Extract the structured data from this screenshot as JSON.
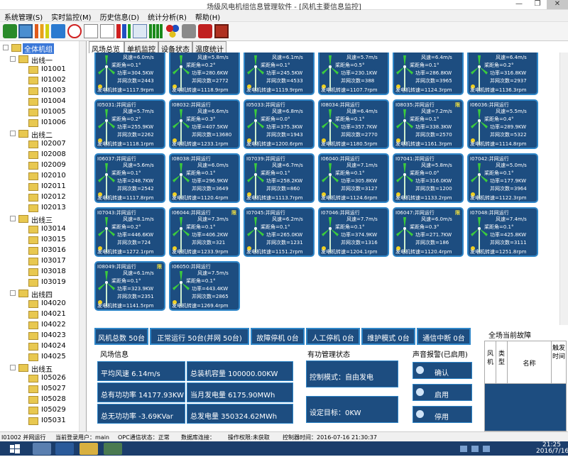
{
  "window": {
    "title": "场级风电机组信息管理软件 - [风机主要信息监控]",
    "minimize": "—",
    "restore": "❐",
    "close": "✕"
  },
  "menu": [
    "系统管理(S)",
    "实时监控(M)",
    "历史信息(D)",
    "统计分析(R)",
    "帮助(H)"
  ],
  "toolbar": [
    "refresh-icon",
    "monitor-icon",
    "bar-chart-icon",
    "area-chart-icon",
    "clock-icon",
    "line-chart-icon",
    "curve-chart-icon",
    "column-chart-icon",
    "text-chart-icon",
    "grid-icon",
    "color-circles-icon",
    "settings-icon",
    "tools-icon",
    "exit-icon"
  ],
  "tree": {
    "root": "全体机组",
    "groups": [
      {
        "name": "出线一",
        "items": [
          "I01001",
          "I01002",
          "I01003",
          "I01004",
          "I01005",
          "I01006"
        ]
      },
      {
        "name": "出线二",
        "items": [
          "I02007",
          "I02008",
          "I02009",
          "I02010",
          "I02011",
          "I02012",
          "I02013"
        ]
      },
      {
        "name": "出线三",
        "items": [
          "I03014",
          "I03015",
          "I03016",
          "I03017",
          "I03018",
          "I03019"
        ]
      },
      {
        "name": "出线四",
        "items": [
          "I04020",
          "I04021",
          "I04022",
          "I04023",
          "I04024",
          "I04025"
        ]
      },
      {
        "name": "出线五",
        "items": [
          "I05026",
          "I05027",
          "I05028",
          "I05029",
          "I05031"
        ]
      }
    ]
  },
  "tabs": [
    "风场总览",
    "单机监控",
    "设备状态",
    "温度统计"
  ],
  "labels": {
    "wind": "风速=",
    "pitch": "桨距角=",
    "power": "功率=",
    "grid": "并网次数=",
    "rpm": "发电机转速="
  },
  "turbines": [
    {
      "name": "",
      "wind": "6.0m/s",
      "pitch": "0.1°",
      "power": "304.5KW",
      "grid": "2443",
      "rpm": "1117.9rpm",
      "limit": ""
    },
    {
      "name": "",
      "wind": "5.8m/s",
      "pitch": "0.2°",
      "power": "280.6KW",
      "grid": "2772",
      "rpm": "1118.9rpm",
      "limit": ""
    },
    {
      "name": "",
      "wind": "6.1m/s",
      "pitch": "0.1°",
      "power": "245.5KW",
      "grid": "4533",
      "rpm": "1119.9rpm",
      "limit": ""
    },
    {
      "name": "",
      "wind": "5.7m/s",
      "pitch": "0.5°",
      "power": "230.1KW",
      "grid": "388",
      "rpm": "1107.7rpm",
      "limit": ""
    },
    {
      "name": "",
      "wind": "6.4m/s",
      "pitch": "0.1°",
      "power": "286.8KW",
      "grid": "3965",
      "rpm": "1124.3rpm",
      "limit": ""
    },
    {
      "name": "",
      "wind": "6.4m/s",
      "pitch": "0.2°",
      "power": "316.8KW",
      "grid": "2937",
      "rpm": "1136.3rpm",
      "limit": ""
    },
    {
      "name": "I05031:并网运行",
      "wind": "5.7m/s",
      "pitch": "0.2°",
      "power": "255.9KW",
      "grid": "2262",
      "rpm": "1118.1rpm",
      "limit": ""
    },
    {
      "name": "I08032:并网运行",
      "wind": "6.6m/s",
      "pitch": "0.3°",
      "power": "407.5KW",
      "grid": "13680",
      "rpm": "1233.1rpm",
      "limit": ""
    },
    {
      "name": "I05033:并网运行",
      "wind": "6.8m/s",
      "pitch": "0.0°",
      "power": "375.3KW",
      "grid": "1943",
      "rpm": "1200.6rpm",
      "limit": ""
    },
    {
      "name": "I08034:并网运行",
      "wind": "6.4m/s",
      "pitch": "0.1°",
      "power": "357.7KW",
      "grid": "2770",
      "rpm": "1180.5rpm",
      "limit": ""
    },
    {
      "name": "I08035:并网运行",
      "wind": "7.2m/s",
      "pitch": "0.1°",
      "power": "338.3KW",
      "grid": "2570",
      "rpm": "1161.3rpm",
      "limit": "限"
    },
    {
      "name": "I06036:并网运行",
      "wind": "5.5m/s",
      "pitch": "0.4°",
      "power": "289.9KW",
      "grid": "5322",
      "rpm": "1114.8rpm",
      "limit": ""
    },
    {
      "name": "I06037:并网运行",
      "wind": "5.6m/s",
      "pitch": "0.1°",
      "power": "248.7KW",
      "grid": "2542",
      "rpm": "1117.8rpm",
      "limit": ""
    },
    {
      "name": "I08038:并网运行",
      "wind": "6.0m/s",
      "pitch": "0.1°",
      "power": "296.9KW",
      "grid": "3649",
      "rpm": "1120.4rpm",
      "limit": ""
    },
    {
      "name": "I07039:并网运行",
      "wind": "6.7m/s",
      "pitch": "0.1°",
      "power": "258.2KW",
      "grid": "860",
      "rpm": "1113.7rpm",
      "limit": ""
    },
    {
      "name": "I06040:并网运行",
      "wind": "7.1m/s",
      "pitch": "0.1°",
      "power": "305.8KW",
      "grid": "3127",
      "rpm": "1124.6rpm",
      "limit": ""
    },
    {
      "name": "I07041:并网运行",
      "wind": "5.8m/s",
      "pitch": "0.0°",
      "power": "316.0KW",
      "grid": "1200",
      "rpm": "1133.2rpm",
      "limit": ""
    },
    {
      "name": "I07042:并网运行",
      "wind": "5.0m/s",
      "pitch": "0.1°",
      "power": "177.9KW",
      "grid": "3964",
      "rpm": "1122.3rpm",
      "limit": ""
    },
    {
      "name": "I07043:并网运行",
      "wind": "8.1m/s",
      "pitch": "0.2°",
      "power": "446.6KW",
      "grid": "724",
      "rpm": "1272.1rpm",
      "limit": ""
    },
    {
      "name": "I06044:并网运行",
      "wind": "7.3m/s",
      "pitch": "0.1°",
      "power": "406.2KW",
      "grid": "321",
      "rpm": "1233.9rpm",
      "limit": "限"
    },
    {
      "name": "I07045:并网运行",
      "wind": "6.2m/s",
      "pitch": "0.1°",
      "power": "265.0KW",
      "grid": "1231",
      "rpm": "1151.2rpm",
      "limit": ""
    },
    {
      "name": "I07046:并网运行",
      "wind": "7.7m/s",
      "pitch": "0.1°",
      "power": "374.9KW",
      "grid": "1316",
      "rpm": "1204.1rpm",
      "limit": ""
    },
    {
      "name": "I06047:并网运行",
      "wind": "6.0m/s",
      "pitch": "0.3°",
      "power": "271.7KW",
      "grid": "186",
      "rpm": "1120.4rpm",
      "limit": "限"
    },
    {
      "name": "I07048:并网运行",
      "wind": "7.4m/s",
      "pitch": "0.1°",
      "power": "425.8KW",
      "grid": "3111",
      "rpm": "1251.8rpm",
      "limit": ""
    },
    {
      "name": "I08049:并网运行",
      "wind": "6.1m/s",
      "pitch": "0.1°",
      "power": "323.9KW",
      "grid": "2351",
      "rpm": "1141.5rpm",
      "limit": "限"
    },
    {
      "name": "I06050:并网运行",
      "wind": "7.5m/s",
      "pitch": "0.1°",
      "power": "443.4KW",
      "grid": "2865",
      "rpm": "1269.4rpm",
      "limit": ""
    }
  ],
  "summary": [
    "风机总数 50台",
    "正常运行 50台(并网 50台)",
    "故障停机 0台",
    "人工停机 0台",
    "维护模式 0台",
    "通信中断 0台"
  ],
  "farm": {
    "title": "风场信息",
    "avg_wind": "平均风速   6.14m/s",
    "capacity": "总装机容量 100000.00KW",
    "active_power": "总有功功率 14177.93KW",
    "month_energy": "当月发电量 6175.90MWh",
    "reactive_power": "总无功功率 -3.69KVar",
    "total_energy": "总发电量    350324.62MWh"
  },
  "active_mgmt": {
    "title": "有功管理状态",
    "mode": "控制模式：自由发电",
    "target": "设定目标：0KW"
  },
  "alarm": {
    "title": "声音报警(已启用)",
    "confirm": "确认",
    "enable": "启用",
    "disable": "停用"
  },
  "faults": {
    "title": "全场当前故障",
    "cols": [
      "风机",
      "类型",
      "名称",
      "触发时间"
    ]
  },
  "status": {
    "unit": "I01002 并网运行",
    "user": "当前登录用户：main",
    "opc": "OPC通信状态：正常",
    "db": "数据库连接：",
    "perm": "操作权限:未获取",
    "time": "控制器时间：2016-07-16 21:30:37"
  },
  "taskbar": {
    "time": "21:25",
    "date": "2016/7/16"
  }
}
